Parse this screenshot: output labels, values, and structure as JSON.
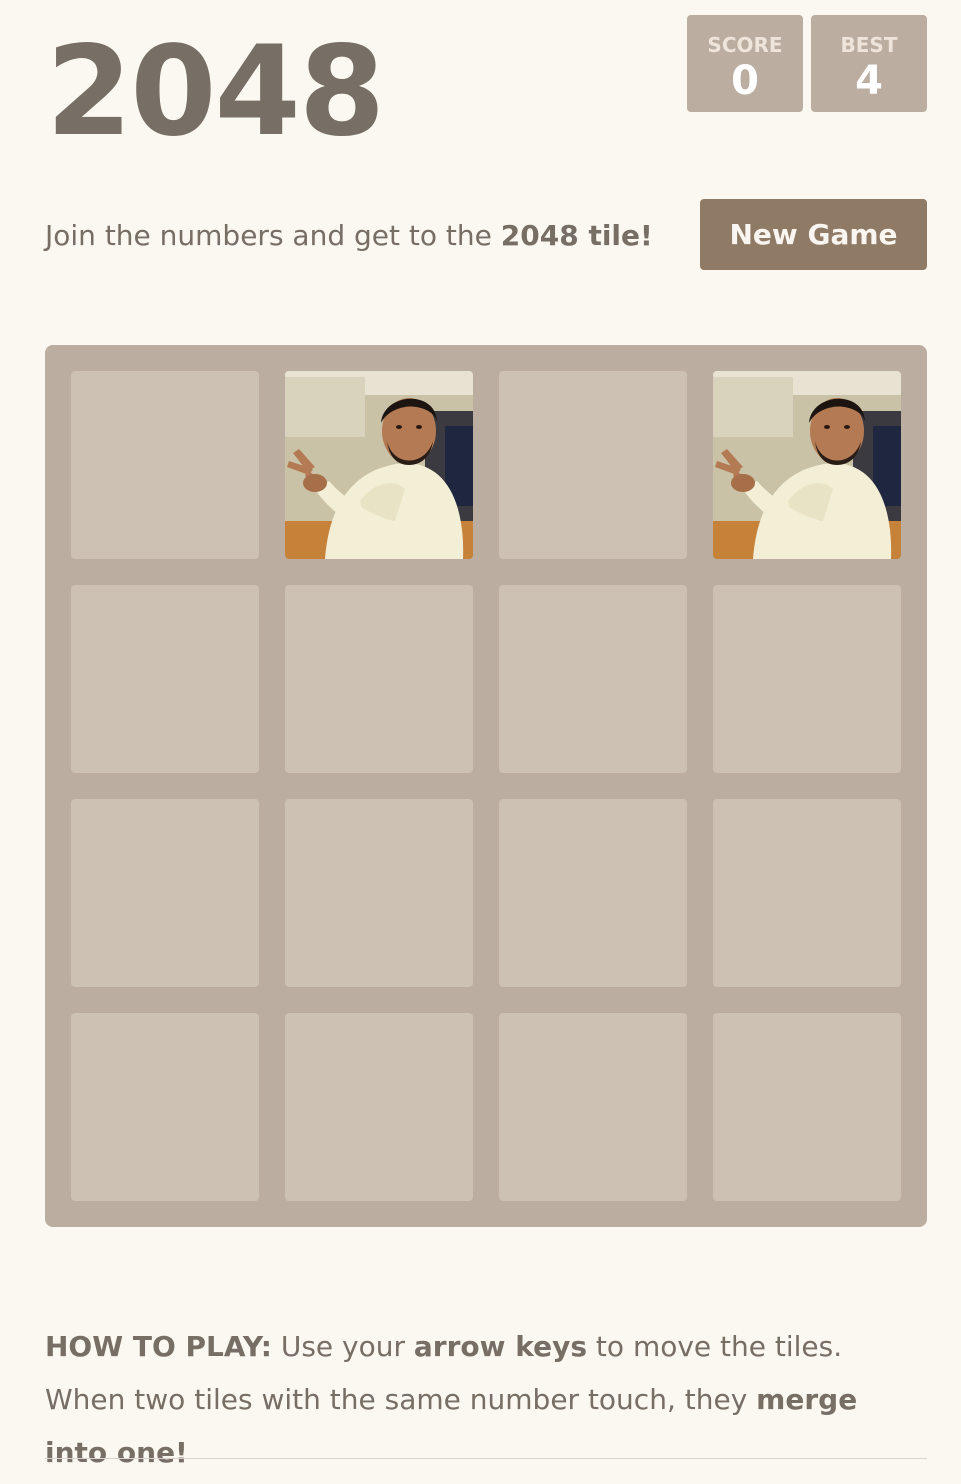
{
  "game": {
    "title": "2048",
    "score_label": "SCORE",
    "score_value": "0",
    "best_label": "BEST",
    "best_value": "4"
  },
  "intro": {
    "text": "Join the numbers and get to the ",
    "highlight": "2048 tile!"
  },
  "new_game_label": "New Game",
  "board": {
    "size": 4,
    "grid": [
      [
        "",
        "photo",
        "",
        "photo"
      ],
      [
        "",
        "",
        "",
        ""
      ],
      [
        "",
        "",
        "",
        ""
      ],
      [
        "",
        "",
        "",
        ""
      ]
    ]
  },
  "how_to_play": {
    "prefix": "HOW TO PLAY:",
    "text1": " Use your ",
    "bold1": "arrow keys",
    "text2": " to move the tiles. When two tiles with the same number touch, they ",
    "bold2": "merge into one!"
  },
  "colors": {
    "background": "#faf8f0",
    "board": "#bbada0",
    "empty_cell": "#cdc1b4",
    "button": "#8f7a66",
    "text": "#776e65"
  }
}
